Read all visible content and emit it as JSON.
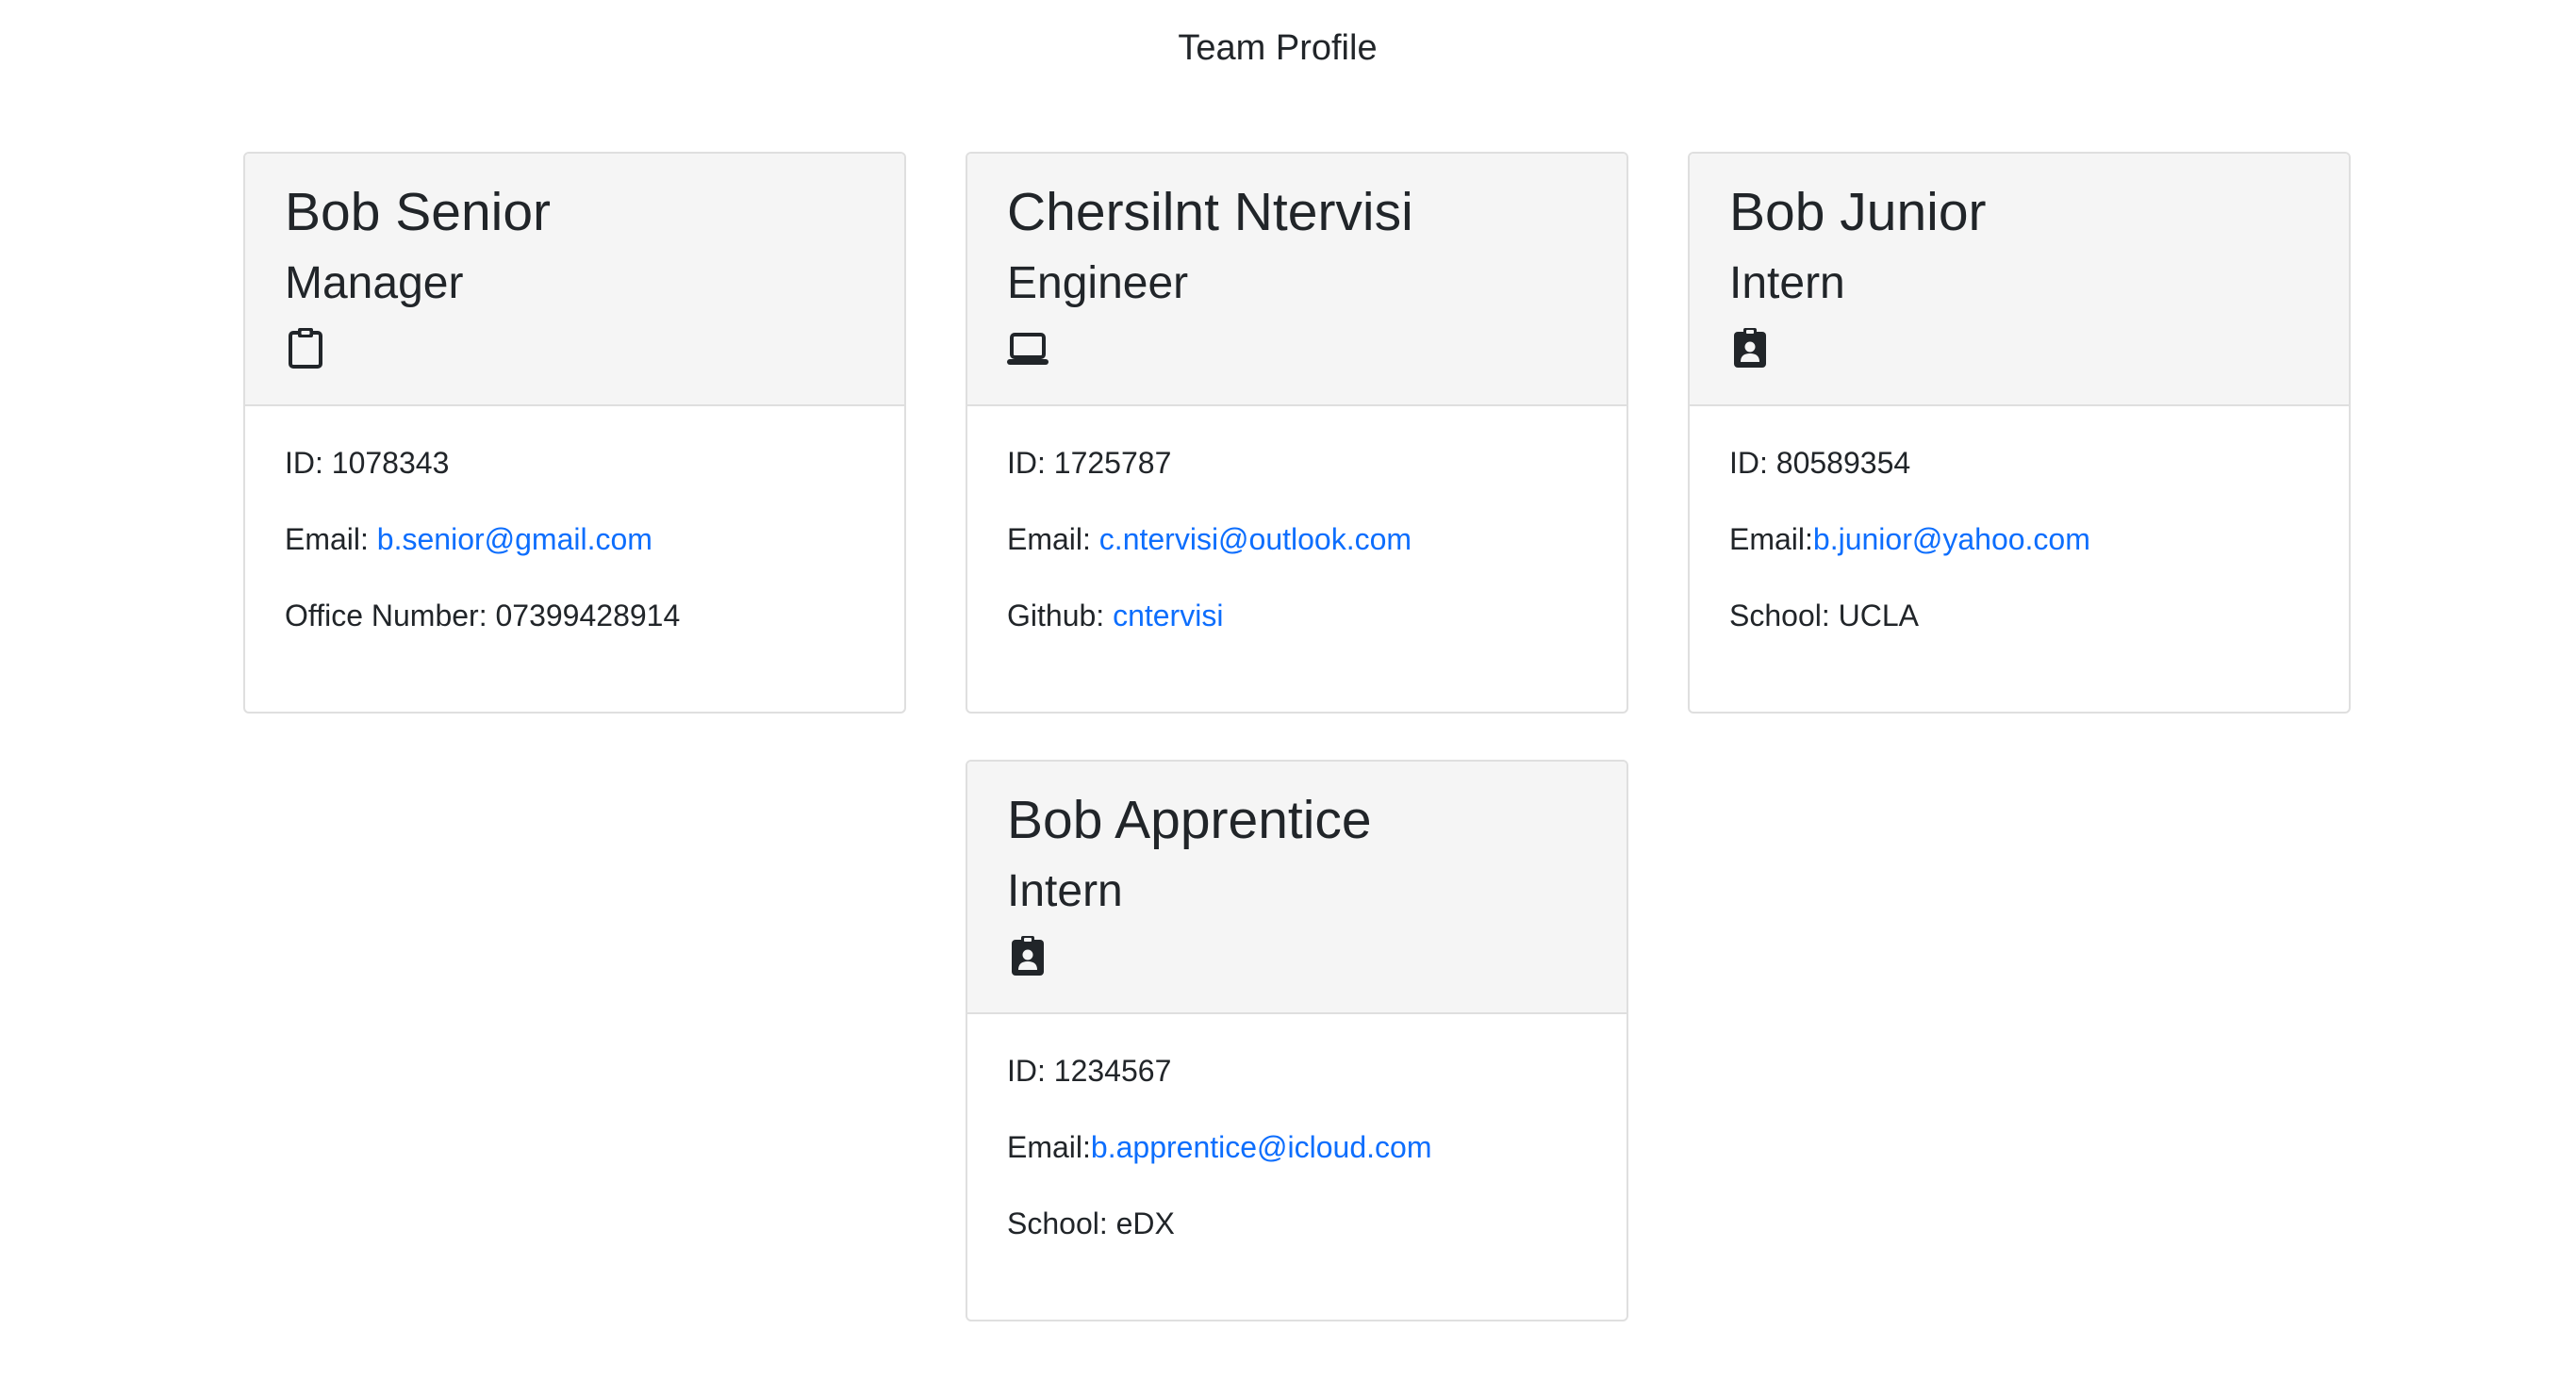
{
  "page": {
    "title": "Team Profile"
  },
  "colors": {
    "link": "#0d6efd",
    "text": "#212529",
    "card_header_bg": "#f5f5f5",
    "card_border": "#dfdfdf"
  },
  "cards": [
    {
      "name": "Bob Senior",
      "role": "Manager",
      "icon": "clipboard-icon",
      "id_line": "ID: 1078343",
      "email_label": "Email: ",
      "email": "b.senior@gmail.com",
      "extra_label": "Office Number: 07399428914",
      "extra_value": ""
    },
    {
      "name": "Chersilnt Ntervisi",
      "role": "Engineer",
      "icon": "laptop-icon",
      "id_line": "ID: 1725787",
      "email_label": "Email: ",
      "email": "c.ntervisi@outlook.com",
      "extra_label": "Github: ",
      "extra_value": "cntervisi"
    },
    {
      "name": "Bob Junior",
      "role": "Intern",
      "icon": "id-badge-icon",
      "id_line": "ID: 80589354",
      "email_label": "Email:",
      "email": "b.junior@yahoo.com",
      "extra_label": "School: UCLA",
      "extra_value": ""
    },
    {
      "name": "Bob Apprentice",
      "role": "Intern",
      "icon": "id-badge-icon",
      "id_line": "ID: 1234567",
      "email_label": "Email:",
      "email": "b.apprentice@icloud.com",
      "extra_label": "School: eDX",
      "extra_value": ""
    }
  ]
}
